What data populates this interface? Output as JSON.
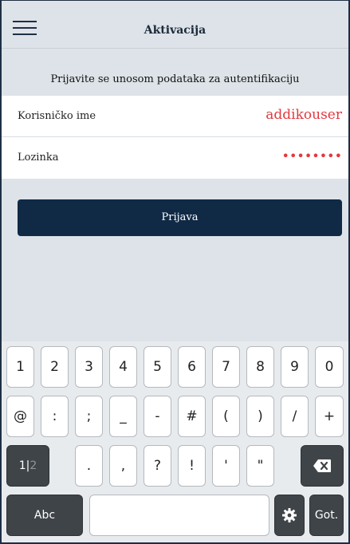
{
  "header": {
    "title": "Aktivacija",
    "menu_icon": "hamburger-menu-icon"
  },
  "instruction": "Prijavite se unosom podataka za autentifikaciju",
  "form": {
    "username_label": "Korisničko ime",
    "username_value": "addikouser",
    "password_label": "Lozinka",
    "password_value": "••••••••"
  },
  "login_button_label": "Prijava",
  "keyboard": {
    "row1": [
      "1",
      "2",
      "3",
      "4",
      "5",
      "6",
      "7",
      "8",
      "9",
      "0"
    ],
    "row2": [
      "@",
      ":",
      ";",
      "_",
      "-",
      "#",
      "(",
      ")",
      "/",
      "+"
    ],
    "row3": [
      ".",
      ",",
      "?",
      "!",
      "'",
      "\""
    ],
    "toggle_primary": "1|",
    "toggle_secondary": "2",
    "abc_label": "Abc",
    "go_label": "Got.",
    "backspace_icon": "backspace-icon",
    "settings_icon": "gear-icon"
  },
  "colors": {
    "accent_red": "#e2393f",
    "primary_navy": "#102a46",
    "background": "#dde3e8"
  }
}
